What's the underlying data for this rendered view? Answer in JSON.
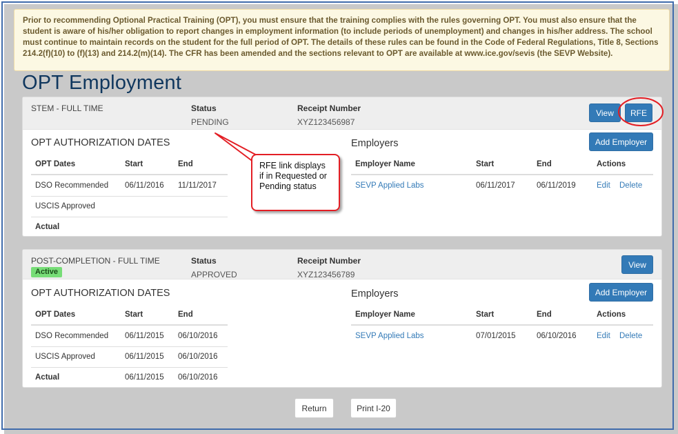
{
  "notice": {
    "text": "Prior to recommending Optional Practical Training (OPT), you must ensure that the training complies with the rules governing OPT. You must also ensure that the student is aware of his/her obligation to report changes in employment information (to include periods of unemployment) and changes in his/her address. The school must continue to maintain records on the student for the full period of OPT. The details of these rules can be found in the Code of Federal Regulations, Title 8, Sections 214.2(f)(10) to (f)(13) and 214.2(m)(14). The CFR has been amended and the sections relevant to OPT are available at www.ice.gov/sevis (the SEVP Website)."
  },
  "page_title": "OPT Employment",
  "labels": {
    "status": "Status",
    "receipt_number": "Receipt Number",
    "auth_dates_heading": "OPT AUTHORIZATION DATES",
    "employers_heading": "Employers",
    "opt_dates": "OPT Dates",
    "start": "Start",
    "end": "End",
    "employer_name": "Employer Name",
    "actions": "Actions",
    "view": "View",
    "rfe": "RFE",
    "add_employer": "Add Employer",
    "edit": "Edit",
    "delete": "Delete"
  },
  "panels": [
    {
      "type": "STEM - FULL TIME",
      "badge": "",
      "status": "PENDING",
      "receipt": "XYZ123456987",
      "dates": [
        {
          "label": "DSO Recommended",
          "start": "06/11/2016",
          "end": "11/11/2017"
        },
        {
          "label": "USCIS Approved",
          "start": "",
          "end": ""
        },
        {
          "label": "Actual",
          "start": "",
          "end": ""
        }
      ],
      "employers": [
        {
          "name": "SEVP Applied Labs",
          "start": "06/11/2017",
          "end": "06/11/2019"
        }
      ]
    },
    {
      "type": "POST-COMPLETION - FULL TIME",
      "badge": "Active",
      "status": "APPROVED",
      "receipt": "XYZ123456789",
      "dates": [
        {
          "label": "DSO Recommended",
          "start": "06/11/2015",
          "end": "06/10/2016"
        },
        {
          "label": "USCIS Approved",
          "start": "06/11/2015",
          "end": "06/10/2016"
        },
        {
          "label": "Actual",
          "start": "06/11/2015",
          "end": "06/10/2016"
        }
      ],
      "employers": [
        {
          "name": "SEVP Applied Labs",
          "start": "07/01/2015",
          "end": "06/10/2016"
        }
      ]
    }
  ],
  "annotation": {
    "text": "RFE link displays if in Requested or Pending status",
    "color": "#e31e24"
  },
  "footer": {
    "return": "Return",
    "print": "Print I-20"
  }
}
